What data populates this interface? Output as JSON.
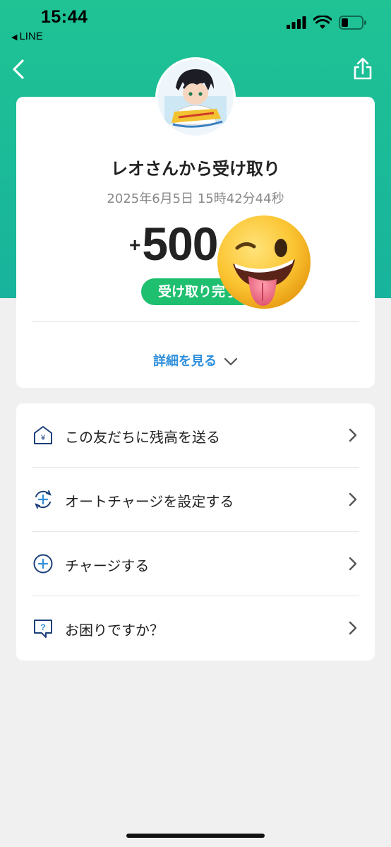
{
  "status_bar": {
    "time": "15:44",
    "back_app": "LINE"
  },
  "header": {
    "back_icon": "chevron-left-icon",
    "share_icon": "share-icon"
  },
  "transaction": {
    "title": "レオさんから受け取り",
    "datetime": "2025年6月5日 15時42分44秒",
    "amount_sign": "+",
    "amount_value": "500",
    "status_badge": "受け取り完了",
    "details_link": "詳細を見る"
  },
  "menu": {
    "items": [
      {
        "label": "この友だちに残高を送る",
        "icon": "send-yen-icon"
      },
      {
        "label": "オートチャージを設定する",
        "icon": "auto-charge-icon"
      },
      {
        "label": "チャージする",
        "icon": "charge-plus-icon"
      },
      {
        "label": "お困りですか？",
        "icon": "help-icon"
      }
    ]
  },
  "colors": {
    "accent_green": "#1fc394",
    "badge_green": "#1fbf70",
    "link_blue": "#2e8fdc",
    "icon_navy": "#1b3f7a"
  }
}
